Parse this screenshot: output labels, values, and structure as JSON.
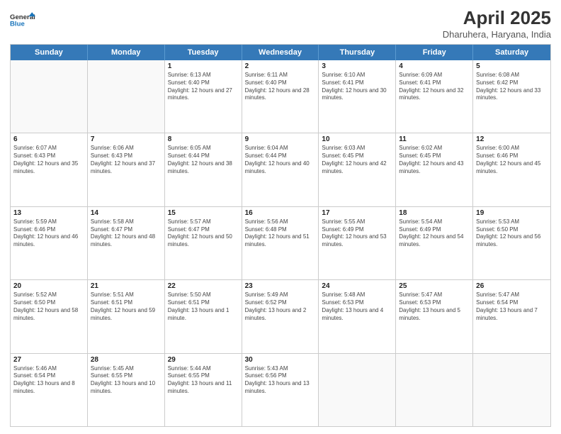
{
  "header": {
    "logo_line1": "General",
    "logo_line2": "Blue",
    "title": "April 2025",
    "subtitle": "Dharuhera, Haryana, India"
  },
  "weekdays": [
    "Sunday",
    "Monday",
    "Tuesday",
    "Wednesday",
    "Thursday",
    "Friday",
    "Saturday"
  ],
  "weeks": [
    [
      {
        "day": "",
        "info": ""
      },
      {
        "day": "",
        "info": ""
      },
      {
        "day": "1",
        "info": "Sunrise: 6:13 AM\nSunset: 6:40 PM\nDaylight: 12 hours and 27 minutes."
      },
      {
        "day": "2",
        "info": "Sunrise: 6:11 AM\nSunset: 6:40 PM\nDaylight: 12 hours and 28 minutes."
      },
      {
        "day": "3",
        "info": "Sunrise: 6:10 AM\nSunset: 6:41 PM\nDaylight: 12 hours and 30 minutes."
      },
      {
        "day": "4",
        "info": "Sunrise: 6:09 AM\nSunset: 6:41 PM\nDaylight: 12 hours and 32 minutes."
      },
      {
        "day": "5",
        "info": "Sunrise: 6:08 AM\nSunset: 6:42 PM\nDaylight: 12 hours and 33 minutes."
      }
    ],
    [
      {
        "day": "6",
        "info": "Sunrise: 6:07 AM\nSunset: 6:43 PM\nDaylight: 12 hours and 35 minutes."
      },
      {
        "day": "7",
        "info": "Sunrise: 6:06 AM\nSunset: 6:43 PM\nDaylight: 12 hours and 37 minutes."
      },
      {
        "day": "8",
        "info": "Sunrise: 6:05 AM\nSunset: 6:44 PM\nDaylight: 12 hours and 38 minutes."
      },
      {
        "day": "9",
        "info": "Sunrise: 6:04 AM\nSunset: 6:44 PM\nDaylight: 12 hours and 40 minutes."
      },
      {
        "day": "10",
        "info": "Sunrise: 6:03 AM\nSunset: 6:45 PM\nDaylight: 12 hours and 42 minutes."
      },
      {
        "day": "11",
        "info": "Sunrise: 6:02 AM\nSunset: 6:45 PM\nDaylight: 12 hours and 43 minutes."
      },
      {
        "day": "12",
        "info": "Sunrise: 6:00 AM\nSunset: 6:46 PM\nDaylight: 12 hours and 45 minutes."
      }
    ],
    [
      {
        "day": "13",
        "info": "Sunrise: 5:59 AM\nSunset: 6:46 PM\nDaylight: 12 hours and 46 minutes."
      },
      {
        "day": "14",
        "info": "Sunrise: 5:58 AM\nSunset: 6:47 PM\nDaylight: 12 hours and 48 minutes."
      },
      {
        "day": "15",
        "info": "Sunrise: 5:57 AM\nSunset: 6:47 PM\nDaylight: 12 hours and 50 minutes."
      },
      {
        "day": "16",
        "info": "Sunrise: 5:56 AM\nSunset: 6:48 PM\nDaylight: 12 hours and 51 minutes."
      },
      {
        "day": "17",
        "info": "Sunrise: 5:55 AM\nSunset: 6:49 PM\nDaylight: 12 hours and 53 minutes."
      },
      {
        "day": "18",
        "info": "Sunrise: 5:54 AM\nSunset: 6:49 PM\nDaylight: 12 hours and 54 minutes."
      },
      {
        "day": "19",
        "info": "Sunrise: 5:53 AM\nSunset: 6:50 PM\nDaylight: 12 hours and 56 minutes."
      }
    ],
    [
      {
        "day": "20",
        "info": "Sunrise: 5:52 AM\nSunset: 6:50 PM\nDaylight: 12 hours and 58 minutes."
      },
      {
        "day": "21",
        "info": "Sunrise: 5:51 AM\nSunset: 6:51 PM\nDaylight: 12 hours and 59 minutes."
      },
      {
        "day": "22",
        "info": "Sunrise: 5:50 AM\nSunset: 6:51 PM\nDaylight: 13 hours and 1 minute."
      },
      {
        "day": "23",
        "info": "Sunrise: 5:49 AM\nSunset: 6:52 PM\nDaylight: 13 hours and 2 minutes."
      },
      {
        "day": "24",
        "info": "Sunrise: 5:48 AM\nSunset: 6:53 PM\nDaylight: 13 hours and 4 minutes."
      },
      {
        "day": "25",
        "info": "Sunrise: 5:47 AM\nSunset: 6:53 PM\nDaylight: 13 hours and 5 minutes."
      },
      {
        "day": "26",
        "info": "Sunrise: 5:47 AM\nSunset: 6:54 PM\nDaylight: 13 hours and 7 minutes."
      }
    ],
    [
      {
        "day": "27",
        "info": "Sunrise: 5:46 AM\nSunset: 6:54 PM\nDaylight: 13 hours and 8 minutes."
      },
      {
        "day": "28",
        "info": "Sunrise: 5:45 AM\nSunset: 6:55 PM\nDaylight: 13 hours and 10 minutes."
      },
      {
        "day": "29",
        "info": "Sunrise: 5:44 AM\nSunset: 6:55 PM\nDaylight: 13 hours and 11 minutes."
      },
      {
        "day": "30",
        "info": "Sunrise: 5:43 AM\nSunset: 6:56 PM\nDaylight: 13 hours and 13 minutes."
      },
      {
        "day": "",
        "info": ""
      },
      {
        "day": "",
        "info": ""
      },
      {
        "day": "",
        "info": ""
      }
    ]
  ]
}
